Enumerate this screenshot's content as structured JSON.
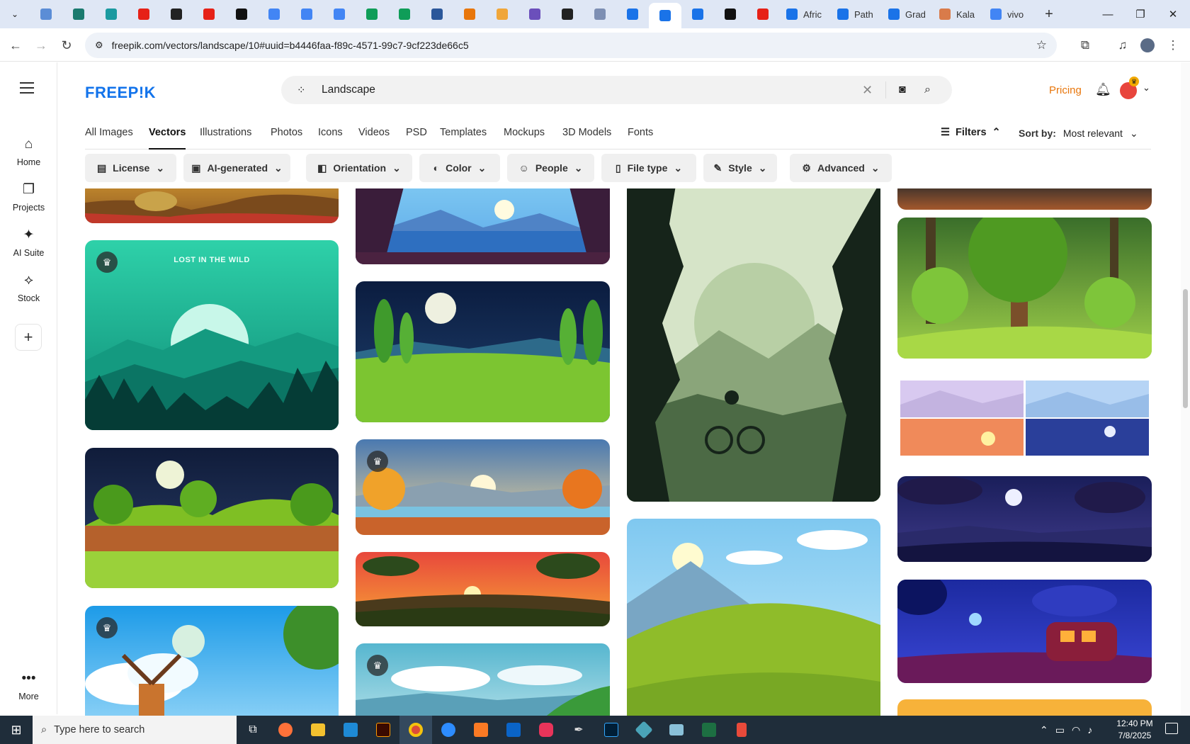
{
  "browser": {
    "tabs": [
      {
        "icon": "globe-icon",
        "color": "#5b8dd6",
        "title": ""
      },
      {
        "icon": "vpn-icon",
        "color": "#1a7a6e",
        "title": ""
      },
      {
        "icon": "play-icon",
        "color": "#1b9aa0",
        "title": ""
      },
      {
        "icon": "youtube-icon",
        "color": "#e62117",
        "title": ""
      },
      {
        "icon": "openai-icon",
        "color": "#222222",
        "title": ""
      },
      {
        "icon": "youtube-icon",
        "color": "#e62117",
        "title": ""
      },
      {
        "icon": "bolt-icon",
        "color": "#111111",
        "title": ""
      },
      {
        "icon": "docs-icon",
        "color": "#4285f4",
        "title": ""
      },
      {
        "icon": "docs-icon",
        "color": "#4285f4",
        "title": ""
      },
      {
        "icon": "docs-icon",
        "color": "#4285f4",
        "title": ""
      },
      {
        "icon": "sheets-icon",
        "color": "#0f9d58",
        "title": ""
      },
      {
        "icon": "sheets-icon",
        "color": "#0f9d58",
        "title": ""
      },
      {
        "icon": "word-icon",
        "color": "#2b579a",
        "title": ""
      },
      {
        "icon": "ninja-icon",
        "color": "#e8760b",
        "title": ""
      },
      {
        "icon": "crown-icon",
        "color": "#f0a63a",
        "title": ""
      },
      {
        "icon": "code-icon",
        "color": "#6b4fbb",
        "title": ""
      },
      {
        "icon": "math-icon",
        "color": "#222222",
        "title": ""
      },
      {
        "icon": "grid-icon",
        "color": "#7d8fb3",
        "title": ""
      },
      {
        "icon": "forms-icon",
        "color": "#1a73e8",
        "title": ""
      },
      {
        "icon": "forms-icon",
        "color": "#1a73e8",
        "title": "",
        "active": true
      },
      {
        "icon": "forms-icon",
        "color": "#1a73e8",
        "title": ""
      },
      {
        "icon": "medium-icon",
        "color": "#111111",
        "title": ""
      },
      {
        "icon": "youtube-icon",
        "color": "#e62117",
        "title": ""
      },
      {
        "icon": "forms-icon",
        "color": "#1a73e8",
        "title": "Afric"
      },
      {
        "icon": "forms-icon",
        "color": "#1a73e8",
        "title": "Path"
      },
      {
        "icon": "forms-icon",
        "color": "#1a73e8",
        "title": "Grad"
      },
      {
        "icon": "kalam-icon",
        "color": "#d97b4a",
        "title": "Kala"
      },
      {
        "icon": "google-icon",
        "color": "#4285f4",
        "title": "vivo"
      }
    ],
    "url": "freepik.com/vectors/landscape/10#uuid=b4446faa-f89c-4571-99c7-9cf223de66c5"
  },
  "sidebar": {
    "home": "Home",
    "projects": "Projects",
    "ai_suite": "AI Suite",
    "stock": "Stock",
    "more": "More"
  },
  "header": {
    "logo": "FREEP!K",
    "search_value": "Landscape",
    "pricing": "Pricing"
  },
  "categories": [
    "All Images",
    "Vectors",
    "Illustrations",
    "Photos",
    "Icons",
    "Videos",
    "PSD",
    "Templates",
    "Mockups",
    "3D Models",
    "Fonts"
  ],
  "active_category": "Vectors",
  "filters_label": "Filters",
  "sort": {
    "label": "Sort by:",
    "value": "Most relevant"
  },
  "filter_buttons": [
    "License",
    "AI-generated",
    "Orientation",
    "Color",
    "People",
    "File type",
    "Style",
    "Advanced"
  ],
  "poster_text": {
    "title": "LOST IN THE WILD"
  },
  "colors": {
    "accent": "#1273eb",
    "pricing": "#e8760b",
    "taskbar": "#1f2d3a"
  },
  "taskbar": {
    "search_placeholder": "Type here to search",
    "time": "12:40 PM",
    "date": "7/8/2025"
  }
}
